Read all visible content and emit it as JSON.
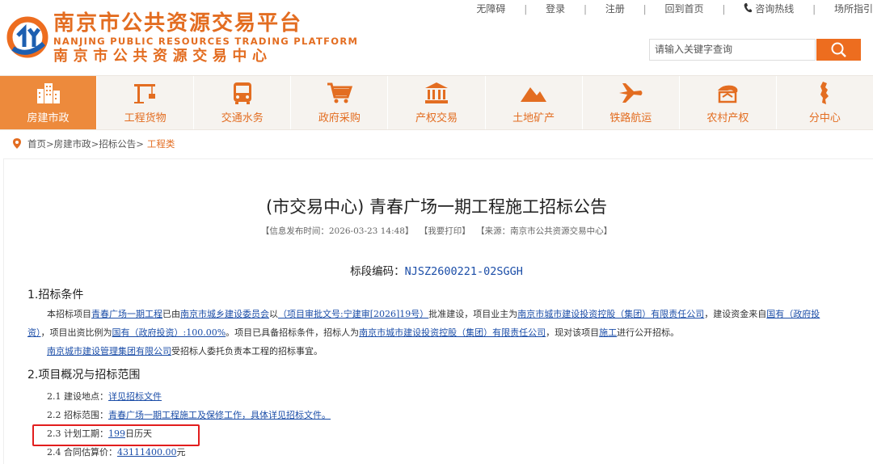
{
  "header": {
    "brand_cn": "南京市公共资源交易平台",
    "brand_en": "NANJING PUBLIC RESOURCES TRADING PLATFORM",
    "brand_cn2": "南京市公共资源交易中心",
    "toplinks": [
      "无障碍",
      "登录",
      "注册",
      "回到首页",
      "咨询热线",
      "场所指引"
    ],
    "separator": "|",
    "search_placeholder": "请输入关键字查询",
    "accent_color": "#ed6d1f"
  },
  "nav": {
    "items": [
      {
        "label": "房建市政",
        "icon": "buildings-icon",
        "active": true
      },
      {
        "label": "工程货物",
        "icon": "crane-icon",
        "active": false
      },
      {
        "label": "交通水务",
        "icon": "bus-icon",
        "active": false
      },
      {
        "label": "政府采购",
        "icon": "cart-icon",
        "active": false
      },
      {
        "label": "产权交易",
        "icon": "bank-icon",
        "active": false
      },
      {
        "label": "土地矿产",
        "icon": "mountain-icon",
        "active": false
      },
      {
        "label": "铁路航运",
        "icon": "airplane-icon",
        "active": false
      },
      {
        "label": "农村产权",
        "icon": "farm-icon",
        "active": false
      },
      {
        "label": "分中心",
        "icon": "map-icon",
        "active": false
      }
    ]
  },
  "breadcrumb": {
    "path": "首页>房建市政>招标公告>",
    "current": "工程类"
  },
  "article": {
    "title": "(市交易中心) 青春广场一期工程施工招标公告",
    "meta": {
      "publish": "【信息发布时间：2026-03-23 14:48】",
      "print": "【我要打印】",
      "source": "【来源：南京市公共资源交易中心】"
    },
    "section_code_label": "标段编码：",
    "section_code": "NJSZ2600221-02SGGH",
    "s1_heading": "1.招标条件",
    "s1": {
      "t1": "本招标项目",
      "l1": "青春广场一期工程",
      "t2": "已由",
      "l2": "南京市城乡建设委员会",
      "t3": "以",
      "l3": "（项目审批文号:宁建审[2026]19号）",
      "t4": "批准建设，项目业主为",
      "l4": "南京市城市建设投资控股（集团）有限责任公司",
      "t5": "，建设资金来自",
      "l5a": "国有（政府投",
      "l5b": "资）",
      "t6": "，项目出资比例为",
      "l6": "国有（政府投资）:100.00%",
      "t7": "。项目已具备招标条件，招标人为",
      "l7": "南京市城市建设投资控股（集团）有限责任公司",
      "t8": "，现对该项目",
      "l8": "施工",
      "t9": "进行公开招标。",
      "l9": "南京城市建设管理集团有限公司",
      "t10": "受招标人委托负责本工程的招标事宜。"
    },
    "s2_heading": "2.项目概况与招标范围",
    "s2": {
      "i1_label": "2.1 建设地点：",
      "i1_value": "详见招标文件",
      "i2_label": "2.2 招标范围：",
      "i2_value": "青春广场一期工程施工及保修工作，具体详见招标文件。",
      "i3_label": "2.3 计划工期：",
      "i3_value": "199",
      "i3_unit": "日历天",
      "i4_label": "2.4 合同估算价：",
      "i4_value": "43111400.00",
      "i4_unit": "元"
    },
    "link_color": "#1c4ea8",
    "highlight_color": "#e21d1d"
  }
}
